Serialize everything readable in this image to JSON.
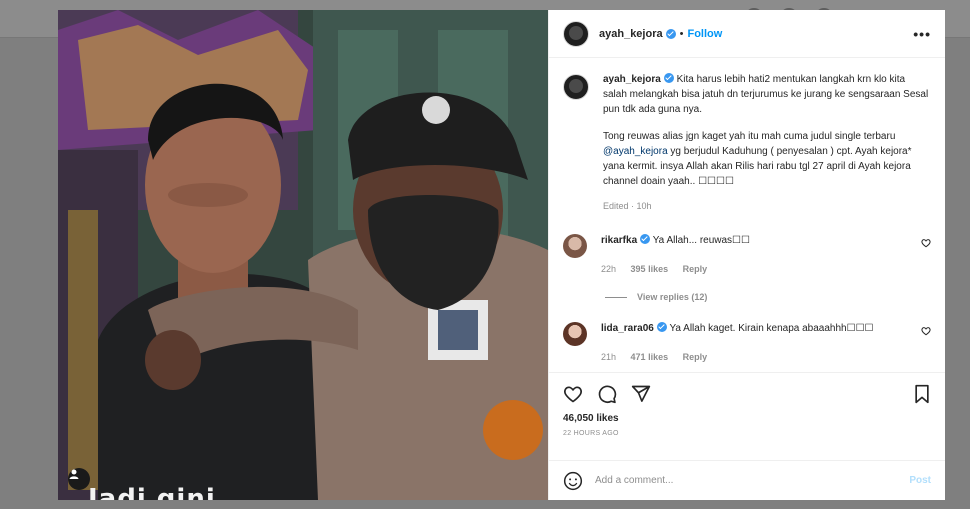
{
  "post": {
    "username": "ayah_kejora",
    "follow_label": "Follow",
    "dot": "•",
    "more_label": "•••",
    "caption_p1": "Kita harus lebih hati2 mentukan langkah krn klo kita salah melangkah bisa jatuh dn terjurumus ke jurang ke sengsaraan Sesal pun tdk ada guna nya.",
    "caption_p2_a": "Tong reuwas alias jgn kaget yah itu mah cuma judul single terbaru",
    "caption_mention": "@ayah_kejora",
    "caption_p2_b": "yg berjudul Kaduhung ( penyesalan ) cpt. Ayah kejora* yana kermit. insya Allah akan Rilis hari rabu tgl 27 april di Ayah kejora channel doain yaah.. ☐☐☐☐",
    "edited_meta": "Edited · 10h",
    "photo_caption": "Jadi gini, ...",
    "likes_total": "46,050 likes",
    "time_ago": "22 HOURS AGO"
  },
  "comments": [
    {
      "username": "rikarfka",
      "text": "Ya Allah... reuwas☐☐",
      "time": "22h",
      "likes": "395 likes",
      "reply_label": "Reply",
      "view_replies": "View replies (12)"
    },
    {
      "username": "lida_rara06",
      "text": "Ya Allah kaget. Kirain kenapa abaaahhh☐☐☐",
      "time": "21h",
      "likes": "471 likes",
      "reply_label": "Reply"
    }
  ],
  "add_comment": {
    "placeholder": "Add a comment...",
    "post_label": "Post"
  },
  "colors": {
    "accent": "#0095f6",
    "verified": "#3897f0",
    "post_disabled": "#b2dffc"
  },
  "icons": [
    "heart-icon",
    "comment-icon",
    "share-icon",
    "bookmark-icon",
    "emoji-icon",
    "verified-icon",
    "more-icon",
    "user-tag-icon"
  ]
}
